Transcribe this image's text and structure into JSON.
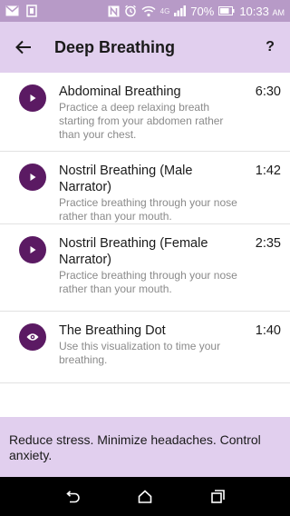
{
  "status_bar": {
    "battery": "70%",
    "time": "10:33",
    "time_suffix": "AM",
    "network": "4G"
  },
  "app_bar": {
    "title": "Deep Breathing",
    "help_label": "?"
  },
  "exercises": [
    {
      "title": "Abdominal Breathing",
      "description": "Practice a deep relaxing breath starting from your abdomen rather than your chest.",
      "duration": "6:30",
      "icon": "play-icon"
    },
    {
      "title": "Nostril Breathing (Male Narrator)",
      "description": "Practice breathing through your nose rather than your mouth.",
      "duration": "1:42",
      "icon": "play-icon"
    },
    {
      "title": "Nostril Breathing (Female Narrator)",
      "description": "Practice breathing through your nose rather than your mouth.",
      "duration": "2:35",
      "icon": "play-icon"
    },
    {
      "title": "The Breathing Dot",
      "description": "Use this visualization to time your breathing.",
      "duration": "1:40",
      "icon": "eye-icon"
    }
  ],
  "footer": {
    "message": "Reduce stress. Minimize headaches. Control anxiety."
  },
  "colors": {
    "accent": "#5b1a63",
    "app_bar": "#e1cfee",
    "status_bar": "#b79ac7"
  }
}
